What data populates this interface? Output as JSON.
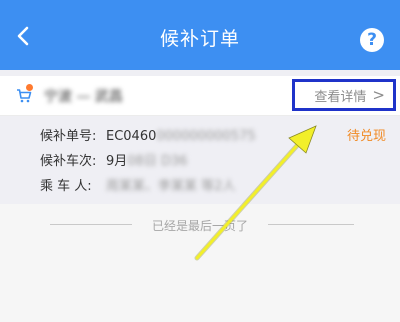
{
  "nav": {
    "title": "候补订单",
    "help_label": "?"
  },
  "order": {
    "route": "宁波 — 武昌",
    "detail_link": "查看详情",
    "detail_chevron": ">",
    "status": "待兑现",
    "rows": [
      {
        "label": "候补单号:",
        "value_visible": "EC0460",
        "value_obscured": "000000000575"
      },
      {
        "label": "候补车次:",
        "value_visible": "9月",
        "value_obscured": "08日 D36"
      },
      {
        "label": "乘 车 人:",
        "value_visible": "",
        "value_obscured": "周某某、李某某 等2人"
      }
    ]
  },
  "footer": {
    "end_text": "已经是最后一页了"
  },
  "colors": {
    "navbar": "#3d8ff2",
    "highlight_box": "#1f33c9",
    "status": "#f08a24",
    "annotation_arrow": "#f2ef2a"
  }
}
